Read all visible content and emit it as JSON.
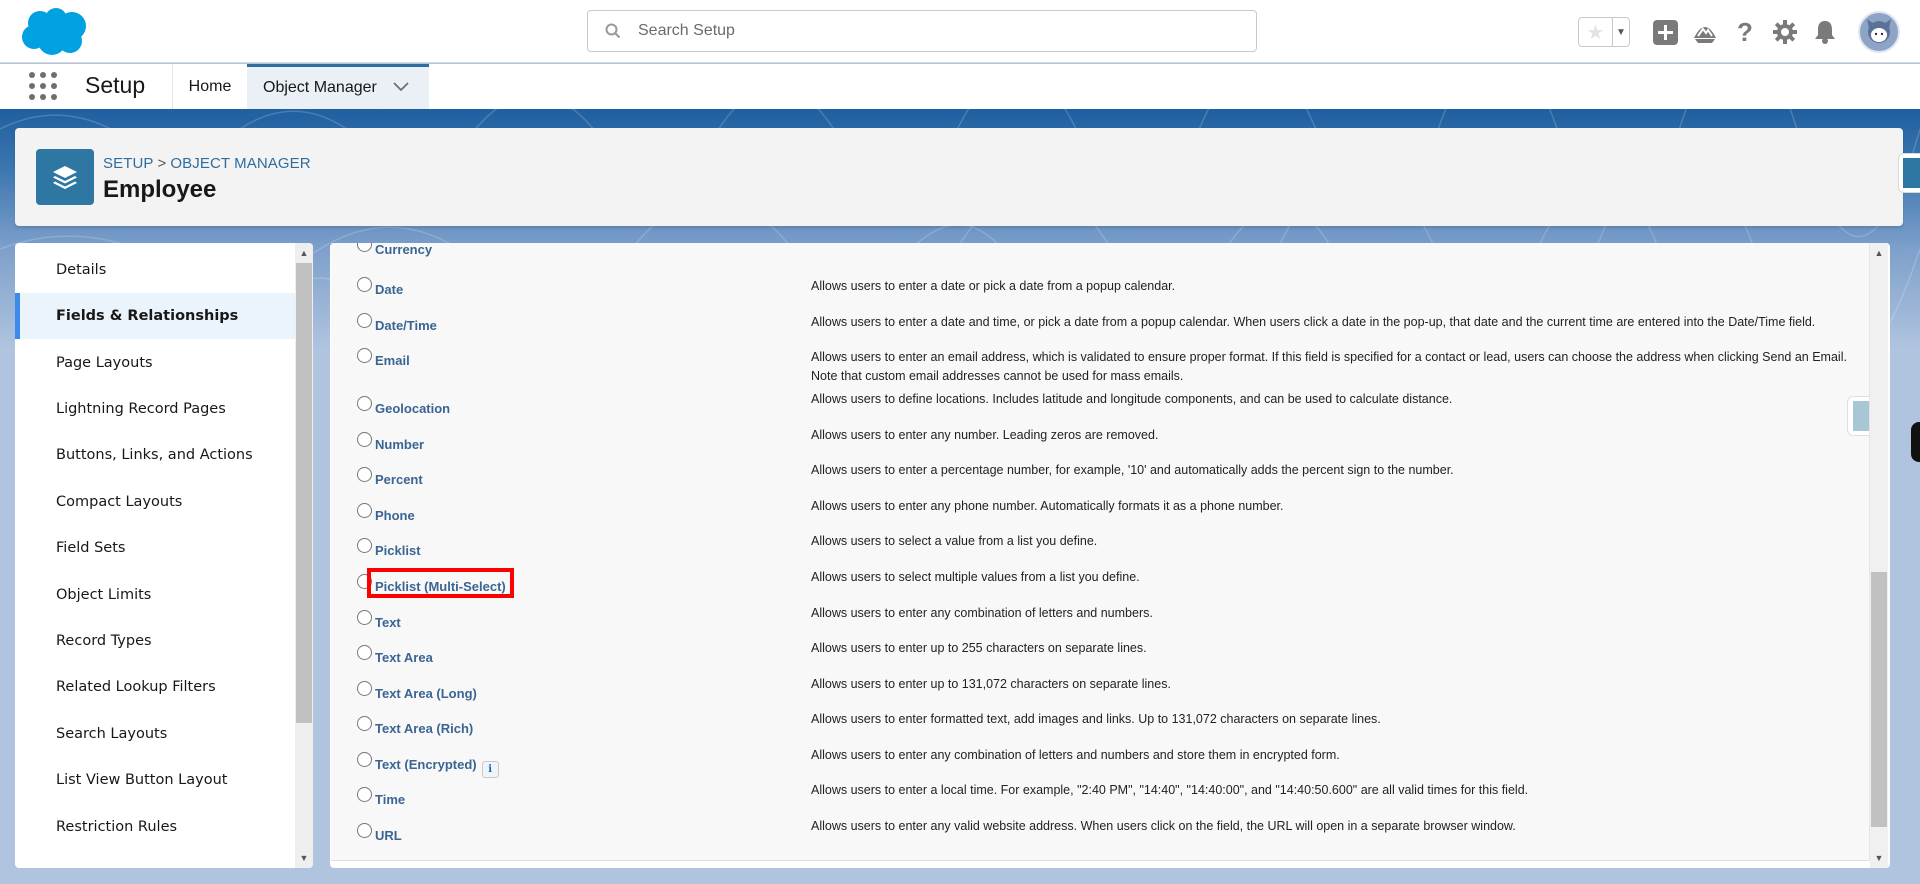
{
  "global_header": {
    "search_placeholder": "Search Setup",
    "icons": [
      "favorites-star-icon",
      "favorites-dropdown-icon",
      "global-actions-add-icon",
      "trailhead-icon",
      "help-icon",
      "setup-gear-icon",
      "notifications-bell-icon",
      "user-avatar"
    ]
  },
  "nav": {
    "app_name": "Setup",
    "tabs": [
      {
        "label": "Home",
        "active": false
      },
      {
        "label": "Object Manager",
        "active": true
      }
    ]
  },
  "page_header": {
    "breadcrumb": [
      "SETUP",
      "OBJECT MANAGER"
    ],
    "breadcrumb_separator": ">",
    "title": "Employee"
  },
  "sidebar": {
    "items": [
      {
        "label": "Details",
        "active": false
      },
      {
        "label": "Fields & Relationships",
        "active": true
      },
      {
        "label": "Page Layouts",
        "active": false
      },
      {
        "label": "Lightning Record Pages",
        "active": false
      },
      {
        "label": "Buttons, Links, and Actions",
        "active": false
      },
      {
        "label": "Compact Layouts",
        "active": false
      },
      {
        "label": "Field Sets",
        "active": false
      },
      {
        "label": "Object Limits",
        "active": false
      },
      {
        "label": "Record Types",
        "active": false
      },
      {
        "label": "Related Lookup Filters",
        "active": false
      },
      {
        "label": "Search Layouts",
        "active": false
      },
      {
        "label": "List View Button Layout",
        "active": false
      },
      {
        "label": "Restriction Rules",
        "active": false
      }
    ]
  },
  "field_types": [
    {
      "label": "Currency",
      "description": "",
      "selected": false
    },
    {
      "label": "Date",
      "description": "Allows users to enter a date or pick a date from a popup calendar.",
      "selected": false
    },
    {
      "label": "Date/Time",
      "description": "Allows users to enter a date and time, or pick a date from a popup calendar. When users click a date in the pop-up, that date and the current time are entered into the Date/Time field.",
      "selected": false
    },
    {
      "label": "Email",
      "description": "Allows users to enter an email address, which is validated to ensure proper format. If this field is specified for a contact or lead, users can choose the address when clicking Send an Email. Note that custom email addresses cannot be used for mass emails.",
      "selected": false
    },
    {
      "label": "Geolocation",
      "description": "Allows users to define locations. Includes latitude and longitude components, and can be used to calculate distance.",
      "selected": false
    },
    {
      "label": "Number",
      "description": "Allows users to enter any number. Leading zeros are removed.",
      "selected": false
    },
    {
      "label": "Percent",
      "description": "Allows users to enter a percentage number, for example, '10' and automatically adds the percent sign to the number.",
      "selected": false
    },
    {
      "label": "Phone",
      "description": "Allows users to enter any phone number. Automatically formats it as a phone number.",
      "selected": false
    },
    {
      "label": "Picklist",
      "description": "Allows users to select a value from a list you define.",
      "selected": false
    },
    {
      "label": "Picklist (Multi-Select)",
      "description": "Allows users to select multiple values from a list you define.",
      "selected": false,
      "highlighted": true
    },
    {
      "label": "Text",
      "description": "Allows users to enter any combination of letters and numbers.",
      "selected": false
    },
    {
      "label": "Text Area",
      "description": "Allows users to enter up to 255 characters on separate lines.",
      "selected": false
    },
    {
      "label": "Text Area (Long)",
      "description": "Allows users to enter up to 131,072 characters on separate lines.",
      "selected": false
    },
    {
      "label": "Text Area (Rich)",
      "description": "Allows users to enter formatted text, add images and links. Up to 131,072 characters on separate lines.",
      "selected": false
    },
    {
      "label": "Text (Encrypted)",
      "description": "Allows users to enter any combination of letters and numbers and store them in encrypted form.",
      "selected": false,
      "info_icon": true
    },
    {
      "label": "Time",
      "description": "Allows users to enter a local time. For example, \"2:40 PM\", \"14:40\", \"14:40:00\", and \"14:40:50.600\" are all valid times for this field.",
      "selected": false
    },
    {
      "label": "URL",
      "description": "Allows users to enter any valid website address. When users click on the field, the URL will open in a separate browser window.",
      "selected": false
    }
  ],
  "info_icon_glyph": "i",
  "colors": {
    "brand_blue": "#00a1e0",
    "link_blue": "#3a6592",
    "highlight_red": "#ff0000",
    "active_tab_border": "#2e6d9e",
    "object_icon_bg": "#2e77a3"
  }
}
